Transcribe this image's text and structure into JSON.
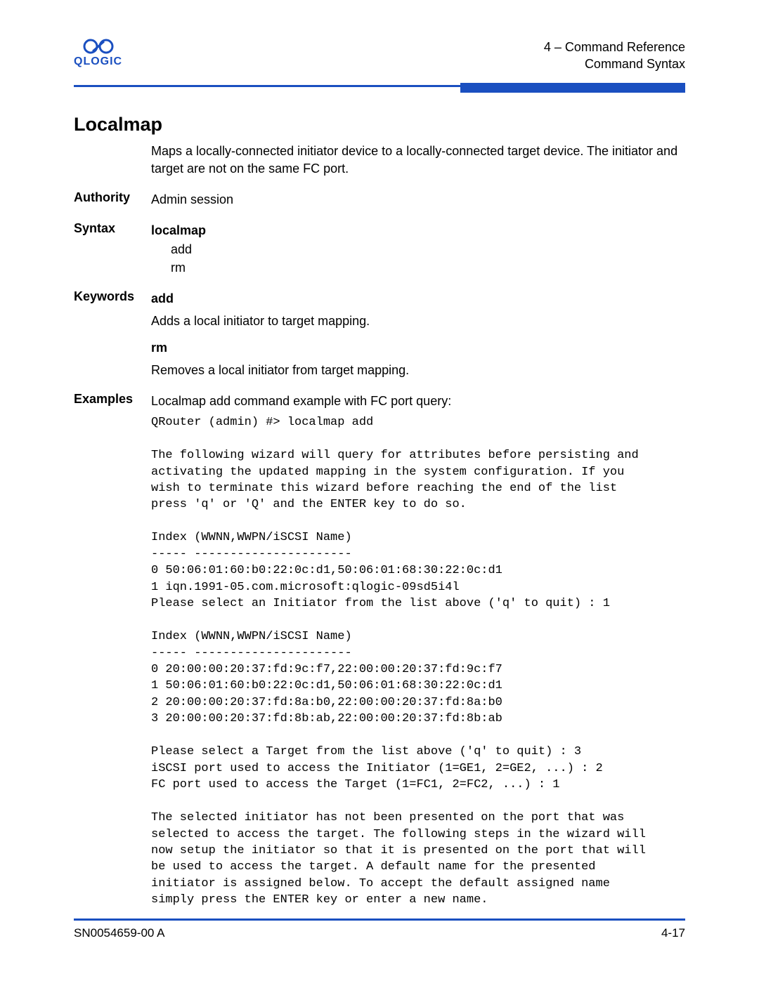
{
  "header": {
    "chapter_line": "4 – Command Reference",
    "section_line": "Command Syntax",
    "logo_text": "QLOGIC"
  },
  "title": "Localmap",
  "intro": "Maps a locally-connected initiator device to a locally-connected target device. The initiator and target are not on the same FC port.",
  "authority": {
    "label": "Authority",
    "text": "Admin session"
  },
  "syntax": {
    "label": "Syntax",
    "cmd": "localmap",
    "opt1": "add",
    "opt2": "rm"
  },
  "keywords": {
    "label": "Keywords",
    "kw1": "add",
    "desc1": "Adds a local initiator to target mapping.",
    "kw2": "rm",
    "desc2": "Removes a local initiator from target mapping."
  },
  "examples": {
    "label": "Examples",
    "lead": "Localmap add command example with FC port query:",
    "block": "QRouter (admin) #> localmap add\n\nThe following wizard will query for attributes before persisting and\nactivating the updated mapping in the system configuration. If you\nwish to terminate this wizard before reaching the end of the list\npress 'q' or 'Q' and the ENTER key to do so.\n\nIndex (WWNN,WWPN/iSCSI Name)\n----- ----------------------\n0 50:06:01:60:b0:22:0c:d1,50:06:01:68:30:22:0c:d1\n1 iqn.1991-05.com.microsoft:qlogic-09sd5i4l\nPlease select an Initiator from the list above ('q' to quit) : 1\n\nIndex (WWNN,WWPN/iSCSI Name)\n----- ----------------------\n0 20:00:00:20:37:fd:9c:f7,22:00:00:20:37:fd:9c:f7\n1 50:06:01:60:b0:22:0c:d1,50:06:01:68:30:22:0c:d1\n2 20:00:00:20:37:fd:8a:b0,22:00:00:20:37:fd:8a:b0\n3 20:00:00:20:37:fd:8b:ab,22:00:00:20:37:fd:8b:ab\n\nPlease select a Target from the list above ('q' to quit) : 3\niSCSI port used to access the Initiator (1=GE1, 2=GE2, ...) : 2\nFC port used to access the Target (1=FC1, 2=FC2, ...) : 1\n\nThe selected initiator has not been presented on the port that was\nselected to access the target. The following steps in the wizard will\nnow setup the initiator so that it is presented on the port that will\nbe used to access the target. A default name for the presented\ninitiator is assigned below. To accept the default assigned name\nsimply press the ENTER key or enter a new name."
  },
  "footer": {
    "left": "SN0054659-00 A",
    "right": "4-17"
  }
}
